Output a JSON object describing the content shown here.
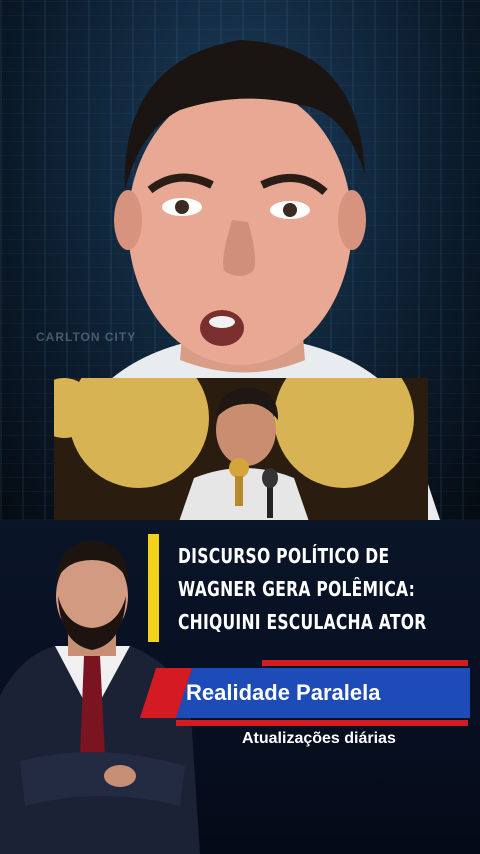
{
  "video": {
    "watermark": "CARLTON CITY",
    "headline_lines": [
      "DISCURSO POLÍTICO DE",
      "WAGNER GERA POLÊMICA:",
      "CHIQUINI ESCULACHA ATOR"
    ],
    "channel_banner": "Realidade Paralela",
    "channel_tagline": "Atualizações diárias"
  },
  "colors": {
    "accent_yellow": "#f2d21a",
    "banner_blue": "#1d4bb7",
    "accent_red": "#d41a22"
  }
}
